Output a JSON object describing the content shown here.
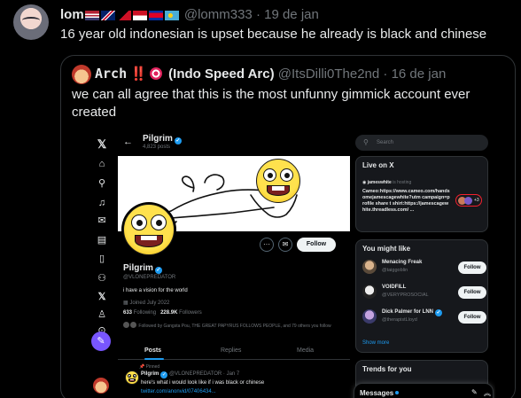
{
  "outer_tweet": {
    "display_name": "lom",
    "flags": [
      "us-flag",
      "uk-flag",
      "png-flag",
      "indonesia-flag",
      "cambodia-flag",
      "palau-flag"
    ],
    "handle": "@lomm333",
    "separator": "·",
    "date": "19 de jan",
    "text": "16 year old indonesian is upset because he already is black and chinese"
  },
  "quoted_tweet": {
    "display_name_prefix": "Arch",
    "display_name_bangs": "‼️",
    "display_name_suffix": "(Indo Speed Arc)",
    "handle": "@ItsDilli0The2nd",
    "separator": "·",
    "date": "16 de jan",
    "text": "we can all agree that this is the most unfunny gimmick account ever created"
  },
  "screenshot": {
    "nav": {
      "icons": [
        "x-logo-icon",
        "home-icon",
        "explore-icon",
        "notifications-icon",
        "messages-icon",
        "lists-icon",
        "bookmarks-icon",
        "communities-icon",
        "premium-icon",
        "profile-icon",
        "more-icon"
      ],
      "post_icon": "feather-icon"
    },
    "profile": {
      "back_arrow": "←",
      "title": "Pilgrim",
      "post_count": "4,823 posts",
      "name": "Pilgrim",
      "handle": "@VLONEPREDATOR",
      "bio": "i have a vision for the world",
      "joined": "Joined July 2022",
      "following_count": "633",
      "following_label": "Following",
      "followers_count": "228.9K",
      "followers_label": "Followers",
      "followed_by": "Followed by Gangsta Pou, THE GREAT PAPYRUS FOLLOWS PEOPLE, and 79 others you follow",
      "more_button": "···",
      "message_button": "✉",
      "follow_button": "Follow",
      "tabs": [
        "Posts",
        "Replies",
        "Media"
      ],
      "active_tab": "Posts"
    },
    "pinned_tweet": {
      "pinned_label": "Pinned",
      "name": "Pilgrim",
      "handle_date": "@VLONEPREDATOR · Jan 7",
      "text": "here's what i would look like if i was black or chinese",
      "link": "twitter.com/anonvid/07406434..."
    },
    "sidebar": {
      "search_placeholder": "Search",
      "live_title": "Live on X",
      "live_user": "jameswhite",
      "live_status": "is hosting",
      "live_text": "Cameo:https://www.cameo.com/handsomejamescagewhite?utm campaign=profile share t shirt:https://jamescagewhite.threadless.com/ ...",
      "live_count": "+3",
      "you_might_like_title": "You might like",
      "suggestions": [
        {
          "name": "Menacing Freak",
          "handle": "@taiggoblin",
          "button": "Follow"
        },
        {
          "name": "VOIDFILL",
          "handle": "@VERYPROSOCIAL",
          "button": "Follow"
        },
        {
          "name": "Dick Palmer for LNN",
          "handle": "@therapistLloyd",
          "button": "Follow"
        }
      ],
      "show_more": "Show more",
      "trends_title": "Trends for you",
      "messages_label": "Messages"
    }
  },
  "colors": {
    "background": "#000000",
    "text_primary": "#e7e9ea",
    "text_secondary": "#71767b",
    "border": "#2f3336",
    "link_blue": "#1d9bf0",
    "post_button": "#7856ff"
  }
}
